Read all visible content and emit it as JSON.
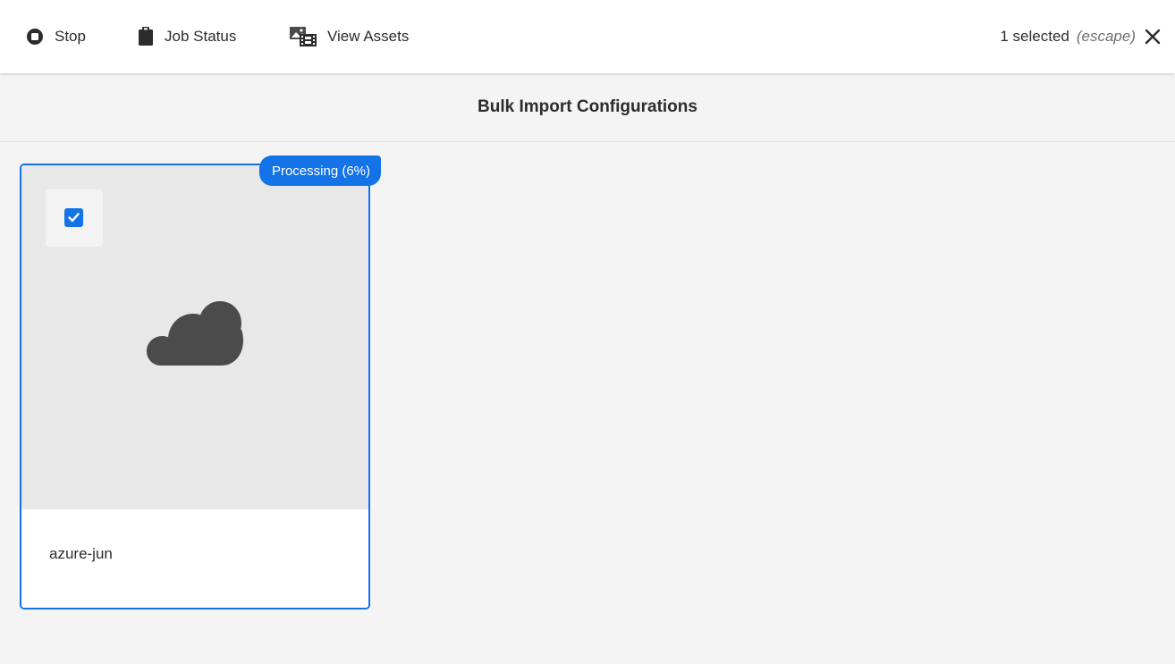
{
  "toolbar": {
    "stop_label": "Stop",
    "job_status_label": "Job Status",
    "view_assets_label": "View Assets",
    "selection_count": "1 selected",
    "selection_hint": "(escape)"
  },
  "header": {
    "title": "Bulk Import Configurations"
  },
  "cards": [
    {
      "title": "azure-jun",
      "status": "Processing (6%)",
      "progress_percent": 6,
      "selected": true,
      "icon": "cloud-icon"
    }
  ],
  "colors": {
    "accent": "#1473e6",
    "background": "#f4f4f4",
    "thumbnail": "#e8e8e8",
    "icon": "#4b4b4b"
  }
}
